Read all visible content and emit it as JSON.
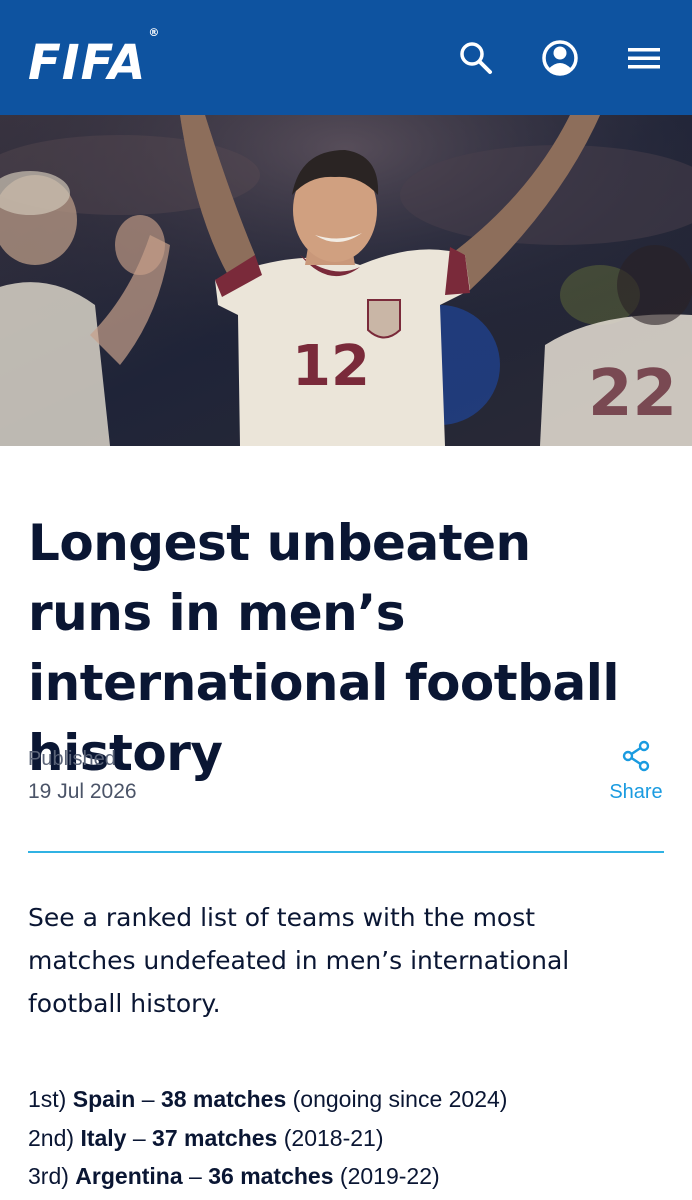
{
  "header": {
    "logo_text": "FIFA",
    "logo_mark": "®",
    "icons": [
      "search-icon",
      "account-icon",
      "menu-icon"
    ],
    "background": "#0e53a0"
  },
  "hero": {
    "shirt_number_center": "12",
    "shirt_number_right": "22"
  },
  "article": {
    "title": "Longest unbeaten runs in men’s international football history",
    "published_label": "Published",
    "published_date": "19 Jul 2026",
    "share_label": "Share",
    "intro": "See a ranked list of teams with the most matches undefeated in men’s international football history.",
    "rankings": [
      {
        "rank": "1st)",
        "team": "Spain",
        "dash": " – ",
        "matches": "38 matches",
        "period": " (ongoing since 2024)"
      },
      {
        "rank": "2nd)",
        "team": "Italy",
        "dash": " – ",
        "matches": "37 matches",
        "period": " (2018-21)"
      },
      {
        "rank": "3rd)",
        "team": "Argentina",
        "dash": " – ",
        "matches": "36 matches",
        "period": " (2019-22)"
      }
    ]
  },
  "colors": {
    "accent": "#1a9be0",
    "divider": "#30b2e3",
    "text": "#0a1633"
  }
}
